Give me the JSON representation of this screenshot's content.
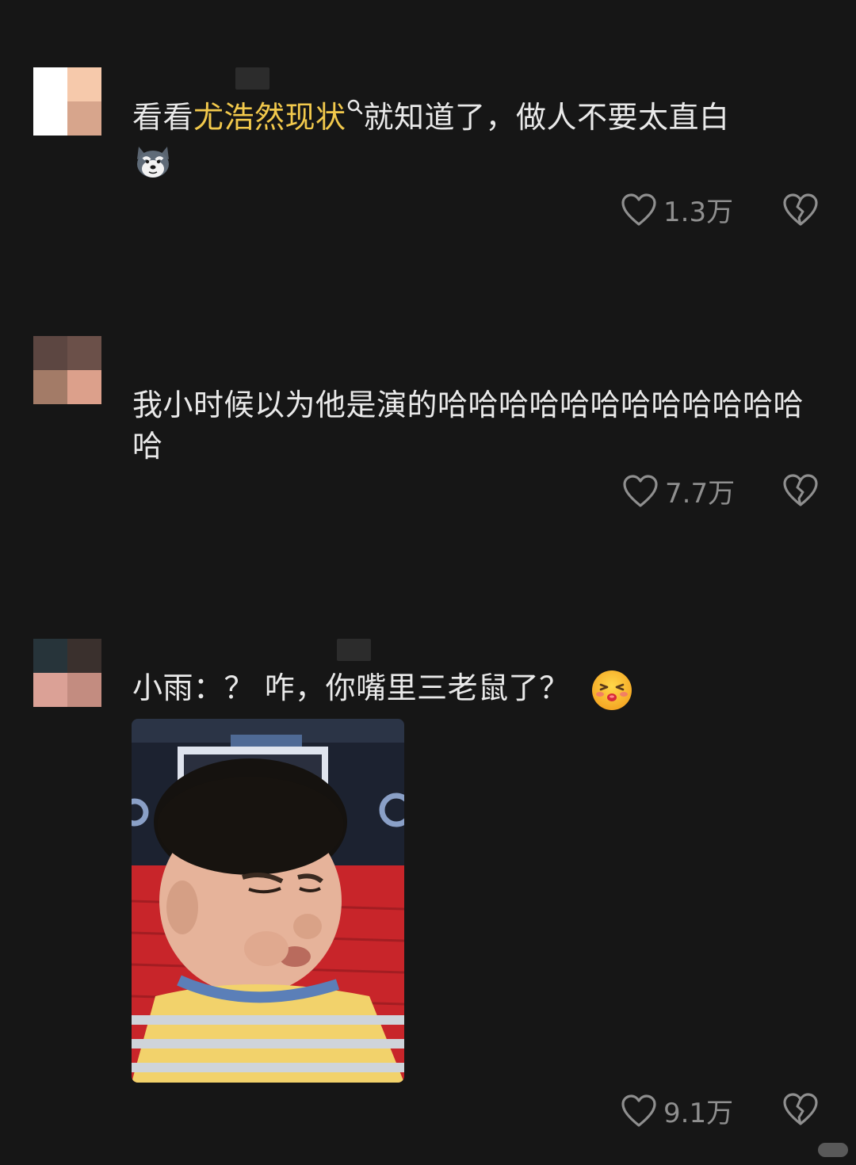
{
  "colors": {
    "background": "#161616",
    "text": "#e9e9e9",
    "highlight": "#f2c94c",
    "meta": "#8f8f8f"
  },
  "comments": [
    {
      "text_before": "看看",
      "highlight": "尤浩然现状",
      "text_after": "就知道了，做人不要太直白",
      "emoji": "husky-dog-face-icon",
      "likes": "1.3万"
    },
    {
      "text": "我小时候以为他是演的哈哈哈哈哈哈哈哈哈哈哈哈哈",
      "likes": "7.7万"
    },
    {
      "text": "小雨：？ 咋，你嘴里三老鼠了？",
      "emoji": "kissing-face-icon",
      "image": "boy-frowning-meme-photo",
      "likes": "9.1万"
    }
  ],
  "icons": {
    "like": "heart-outline-icon",
    "dislike": "broken-heart-icon",
    "search": "search-icon"
  }
}
